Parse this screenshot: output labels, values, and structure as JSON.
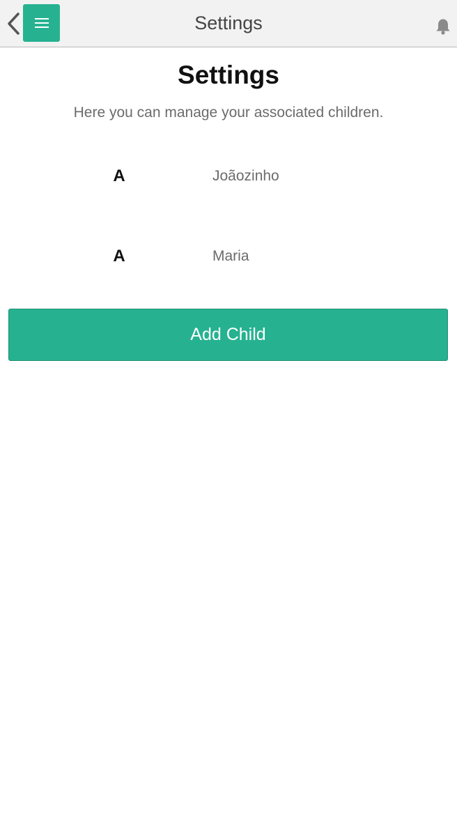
{
  "colors": {
    "accent": "#26b290",
    "nav_background": "#f2f2f2",
    "muted_text": "#6b6b6b",
    "icon_gray": "#8a8a8a"
  },
  "navbar": {
    "title": "Settings",
    "back_icon": "chevron-left-icon",
    "menu_icon": "hamburger-menu-icon",
    "notification_icon": "bell-icon"
  },
  "main": {
    "title": "Settings",
    "description": "Here you can manage your associated children.",
    "children": [
      {
        "avatar": "A",
        "name": "Joãozinho"
      },
      {
        "avatar": "A",
        "name": "Maria"
      }
    ],
    "add_button_label": "Add Child"
  }
}
